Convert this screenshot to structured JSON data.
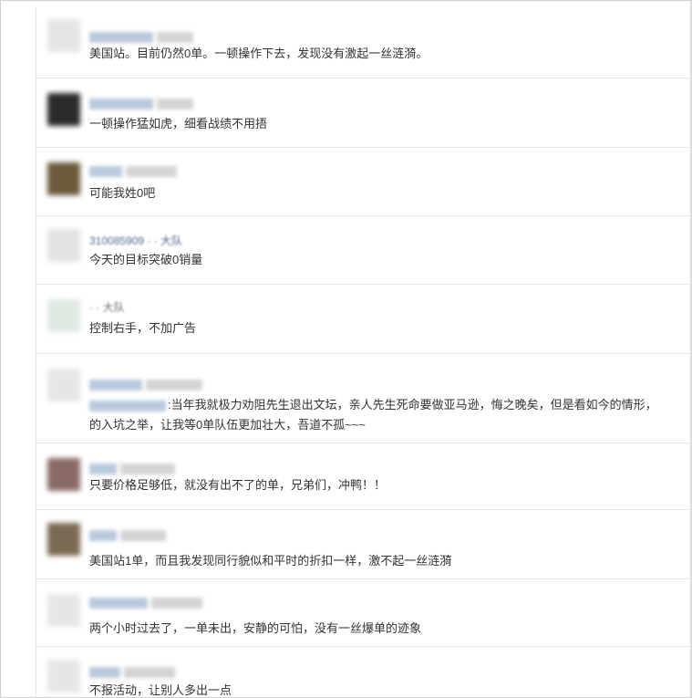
{
  "comments": [
    {
      "name": "",
      "text": "美国站。目前仍然0单。一顿操作下去，发现没有激起一丝涟漪。"
    },
    {
      "name": "",
      "text": "一顿操作猛如虎，细看战绩不用捂"
    },
    {
      "name": "",
      "text": "可能我姓0吧"
    },
    {
      "name": "310085909 · · 大队",
      "text": "今天的目标突破0销量"
    },
    {
      "name": "· ·  大队",
      "text": "控制右手，不加广告"
    },
    {
      "name": "",
      "text": ":当年我就极力劝阻先生退出文坛，亲人先生死命要做亚马逊，悔之晚矣，但是看如今的情形，",
      "text2": "的入坑之举，让我等0单队伍更加壮大，吾道不孤~~~"
    },
    {
      "name": "",
      "text": "只要价格足够低，就没有出不了的单，兄弟们，冲鸭！！"
    },
    {
      "name": "",
      "text": "美国站1单，而且我发现同行貌似和平时的折扣一样，激不起一丝涟漪"
    },
    {
      "name": "",
      "text": "两个小时过去了，一单未出，安静的可怕，没有一丝爆单的迹象"
    },
    {
      "name": "",
      "text": "不报活动，让别人多出一点"
    }
  ],
  "colors": {
    "separator": "#e8e8e8",
    "text": "#333333",
    "name_blur": "#b9c9dd"
  }
}
